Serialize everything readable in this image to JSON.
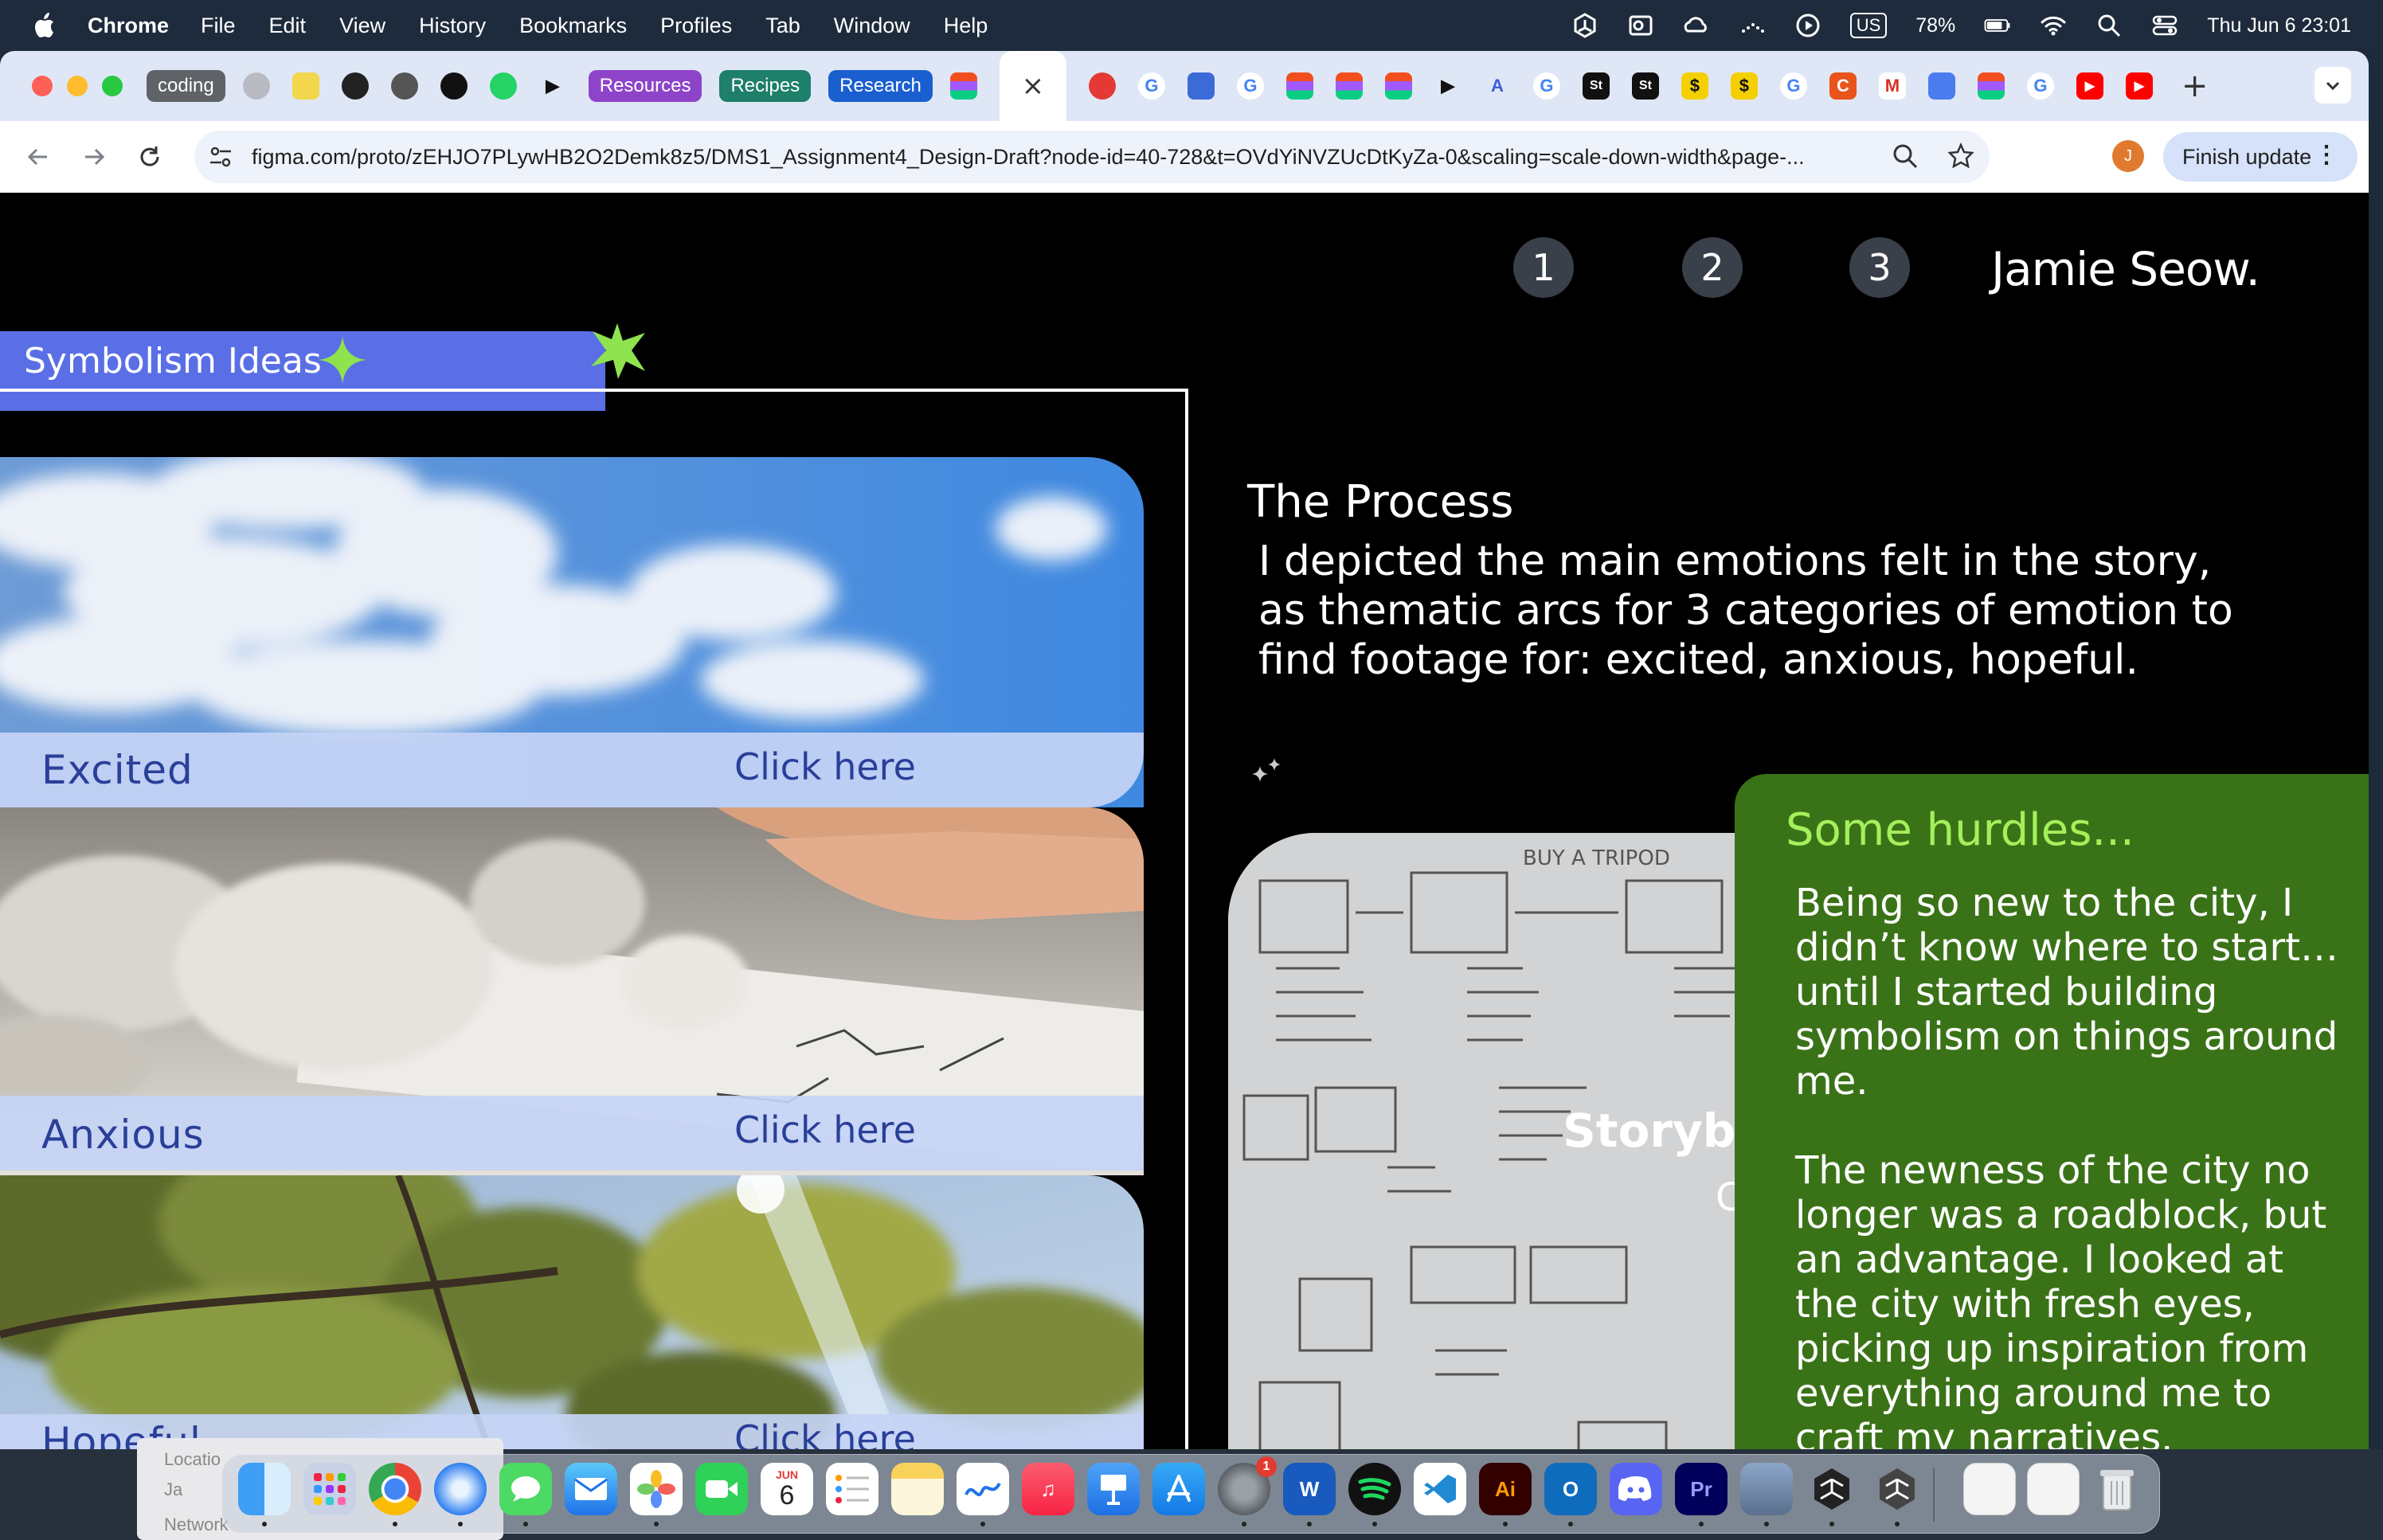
{
  "menubar": {
    "app": "Chrome",
    "items": [
      "File",
      "Edit",
      "View",
      "History",
      "Bookmarks",
      "Profiles",
      "Tab",
      "Window",
      "Help"
    ],
    "keyboard": "US",
    "battery": "78%",
    "clock": "Thu Jun 6  23:01"
  },
  "tabs": {
    "groups": [
      {
        "label": "coding",
        "color": "#5f6368"
      },
      {
        "label": "Resources",
        "color": "#8e44c9"
      },
      {
        "label": "Recipes",
        "color": "#1e7f6a"
      },
      {
        "label": "Research",
        "color": "#1a5fd0"
      }
    ],
    "active_close": "×",
    "new_tab": "+"
  },
  "toolbar": {
    "url": "figma.com/proto/zEHJO7PLywHB2O2Demk8z5/DMS1_Assignment4_Design-Draft?node-id=40-728&t=OVdYiNVZUcDtKyZa-0&scaling=scale-down-width&page-...",
    "avatar": "J",
    "finish_update": "Finish update"
  },
  "page": {
    "nav": [
      "1",
      "2",
      "3"
    ],
    "site_name": "Jamie Seow.",
    "symbolism_title": "Symbolism Ideas",
    "cards": [
      {
        "label": "Excited",
        "cta": "Click here"
      },
      {
        "label": "Anxious",
        "cta": "Click here"
      },
      {
        "label": "Hopeful",
        "cta": "Click here"
      }
    ],
    "process_title": "The Process",
    "process_body": "I depicted the main emotions felt in the story, as thematic arcs for 3 categories of emotion to find footage for: excited, anxious, hopeful.",
    "storyboard_title": "Storyboard",
    "storyboard_sub": "C",
    "hurdles_title": "Some hurdles...",
    "hurdles_p1": "Being so new to the city, I didn’t know where to start…until I started building symbolism on things around me.",
    "hurdles_p2": "The newness of the city no longer was a roadblock, but an advantage. I looked at the city with fresh eyes, picking up inspiration from everything around me to craft my narratives."
  },
  "under_window": {
    "label1": "Locatio",
    "label2": "Ja",
    "label3": "Network"
  },
  "dock": {
    "calendar_month": "JUN",
    "calendar_day": "6",
    "settings_badge": "1",
    "word": "W",
    "illustrator": "Ai",
    "outlook": "O",
    "premiere": "Pr"
  },
  "colors": {
    "accent_blue": "#5a6fe6",
    "green_panel": "#3a7317",
    "green_title": "#a5f05a",
    "card_text": "#2a3f99"
  }
}
